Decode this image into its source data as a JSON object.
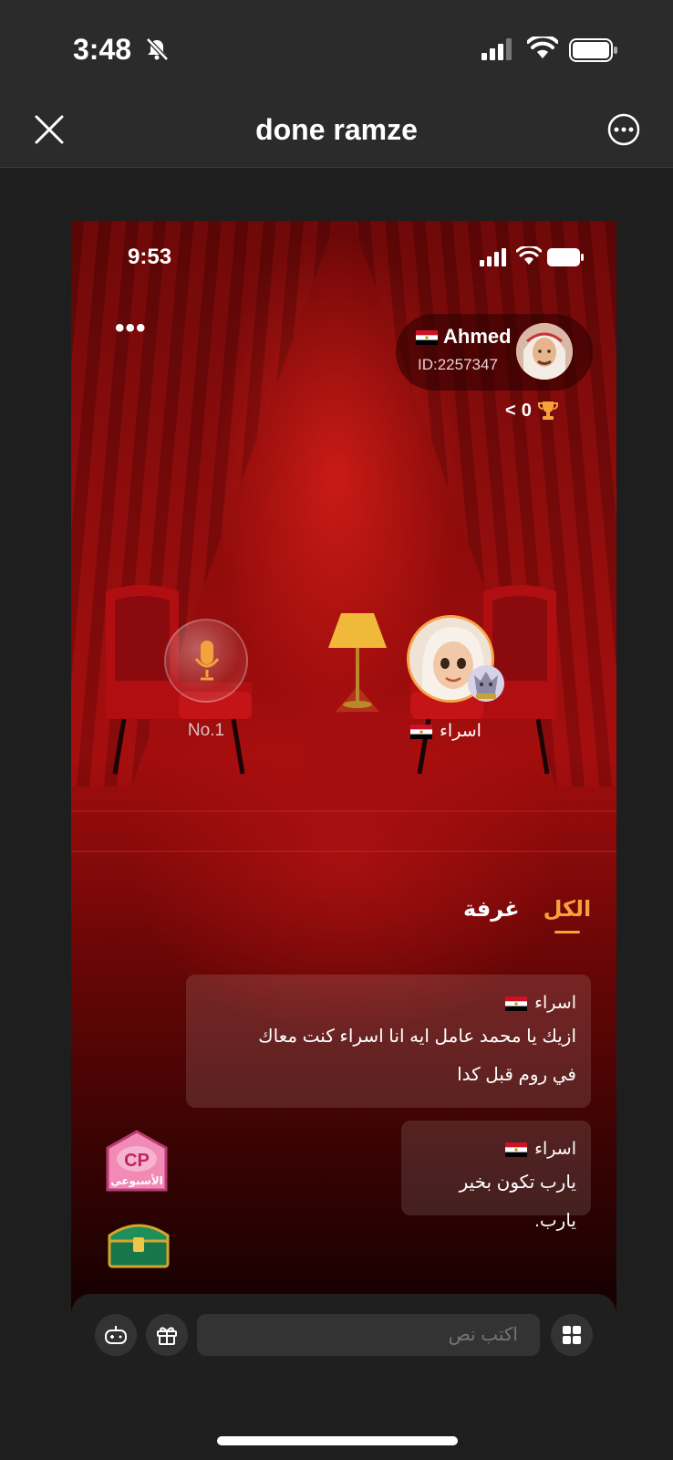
{
  "ios_status": {
    "time": "3:48",
    "icons": [
      "bell-off-icon",
      "signal-icon",
      "wifi-icon",
      "battery-icon"
    ]
  },
  "nav": {
    "title": "done ramze",
    "close_icon": "close-icon",
    "more_icon": "more-circle-icon"
  },
  "room": {
    "status_time": "9:53",
    "menu_dots": "•••",
    "host": {
      "name": "Ahmed",
      "id": "ID:2257347",
      "flag": "egypt-flag-icon"
    },
    "trophy": {
      "count": "0",
      "chevron": "<"
    },
    "seats": [
      {
        "label": "No.1",
        "state": "empty",
        "icon": "microphone-icon"
      },
      {
        "label": "اسراء",
        "state": "occupied",
        "flag": "egypt-flag-icon"
      }
    ],
    "tabs": [
      {
        "label": "الكل",
        "active": true
      },
      {
        "label": "غرفة",
        "active": false
      }
    ],
    "messages": [
      {
        "name": "اسراء",
        "flag": "egypt-flag-icon",
        "text_lines": [
          "ازيك يا محمد عامل ايه انا اسراء كنت معاك",
          "في روم قبل كدا"
        ]
      },
      {
        "name": "اسراء",
        "flag": "egypt-flag-icon",
        "text_lines": [
          "يارب تكون بخير يارب."
        ]
      }
    ],
    "side_badges": [
      {
        "name": "cp-weekly-badge",
        "text_top": "CP",
        "text_bottom": "الأسبوعي"
      },
      {
        "name": "treasure-chest-badge"
      }
    ],
    "composer": {
      "placeholder": "اكتب نص",
      "buttons": [
        "game-controller-icon",
        "gift-box-icon",
        "grid-apps-icon"
      ]
    }
  },
  "colors": {
    "accent": "#f4a23c",
    "background": "#1e1e1e",
    "stage_red": "#a30d0d"
  }
}
